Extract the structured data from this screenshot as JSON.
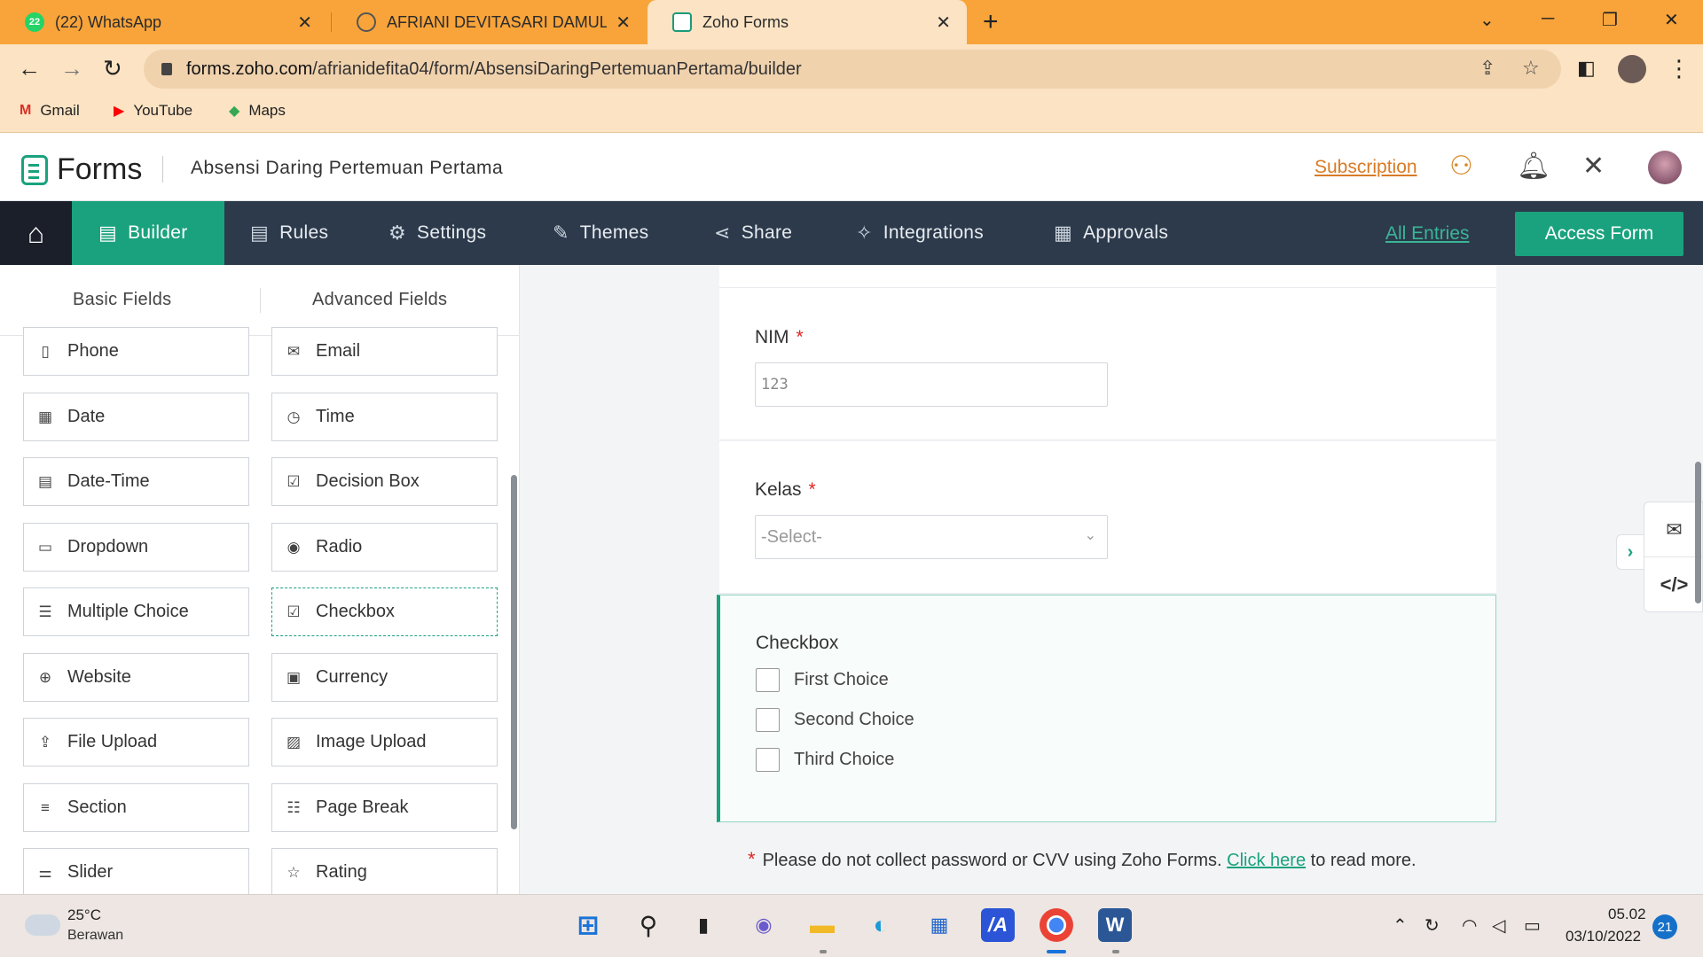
{
  "browser": {
    "tabs": [
      {
        "title": "(22) WhatsApp",
        "badge": "22"
      },
      {
        "title": "AFRIANI DEVITASARI DAMULAWA"
      },
      {
        "title": "Zoho Forms"
      }
    ],
    "new_tab": "+",
    "url_domain": "forms.zoho.com",
    "url_path": "/afrianidefita04/form/AbsensiDaringPertemuanPertama/builder",
    "bookmarks": [
      {
        "label": "Gmail",
        "icon": "gmail-icon",
        "glyph": "M",
        "color": "#d93025"
      },
      {
        "label": "YouTube",
        "icon": "youtube-icon",
        "glyph": "▶",
        "color": "#ff0000"
      },
      {
        "label": "Maps",
        "icon": "maps-icon",
        "glyph": "◆",
        "color": "#34a853"
      }
    ]
  },
  "header": {
    "logo": "Forms",
    "form_title": "Absensi Daring Pertemuan Pertama",
    "subscription": "Subscription"
  },
  "nav": {
    "items": [
      {
        "label": "Builder",
        "icon": "builder-icon",
        "active": true
      },
      {
        "label": "Rules",
        "icon": "rules-icon"
      },
      {
        "label": "Settings",
        "icon": "gear-icon"
      },
      {
        "label": "Themes",
        "icon": "brush-icon"
      },
      {
        "label": "Share",
        "icon": "share-icon"
      },
      {
        "label": "Integrations",
        "icon": "integrations-icon"
      },
      {
        "label": "Approvals",
        "icon": "approvals-icon"
      }
    ],
    "all_entries": "All Entries",
    "access_form": "Access Form"
  },
  "left_panel": {
    "tabs": [
      "Basic Fields",
      "Advanced Fields"
    ],
    "fields": [
      {
        "label": "Phone",
        "icon": "phone-icon",
        "glyph": "▯"
      },
      {
        "label": "Email",
        "icon": "email-icon",
        "glyph": "✉"
      },
      {
        "label": "Date",
        "icon": "calendar-icon",
        "glyph": "▦"
      },
      {
        "label": "Time",
        "icon": "clock-icon",
        "glyph": "◷"
      },
      {
        "label": "Date-Time",
        "icon": "date-time-icon",
        "glyph": "▤"
      },
      {
        "label": "Decision Box",
        "icon": "decision-box-icon",
        "glyph": "☑"
      },
      {
        "label": "Dropdown",
        "icon": "dropdown-icon",
        "glyph": "▭"
      },
      {
        "label": "Radio",
        "icon": "radio-icon",
        "glyph": "◉"
      },
      {
        "label": "Multiple Choice",
        "icon": "multiple-choice-icon",
        "glyph": "☰"
      },
      {
        "label": "Checkbox",
        "icon": "checkbox-icon",
        "glyph": "☑"
      },
      {
        "label": "Website",
        "icon": "globe-icon",
        "glyph": "⊕"
      },
      {
        "label": "Currency",
        "icon": "currency-icon",
        "glyph": "▣"
      },
      {
        "label": "File Upload",
        "icon": "file-upload-icon",
        "glyph": "⇪"
      },
      {
        "label": "Image Upload",
        "icon": "image-upload-icon",
        "glyph": "▨"
      },
      {
        "label": "Section",
        "icon": "section-icon",
        "glyph": "≡"
      },
      {
        "label": "Page Break",
        "icon": "page-break-icon",
        "glyph": "☷"
      },
      {
        "label": "Slider",
        "icon": "slider-icon",
        "glyph": "⚌"
      },
      {
        "label": "Rating",
        "icon": "star-icon",
        "glyph": "☆"
      }
    ]
  },
  "form": {
    "nim_label": "NIM",
    "nim_placeholder": "123",
    "kelas_label": "Kelas",
    "kelas_placeholder": "-Select-",
    "required_mark": "*",
    "checkbox_label": "Checkbox",
    "choices": [
      "First Choice",
      "Second Choice",
      "Third Choice"
    ],
    "notice_text": "Please do not collect password or CVV using Zoho Forms.",
    "notice_link": "Click here",
    "notice_tail": "to read more."
  },
  "taskbar": {
    "temperature": "25°C",
    "weather": "Berawan",
    "time": "05.02",
    "date": "03/10/2022",
    "notifications": "21"
  }
}
